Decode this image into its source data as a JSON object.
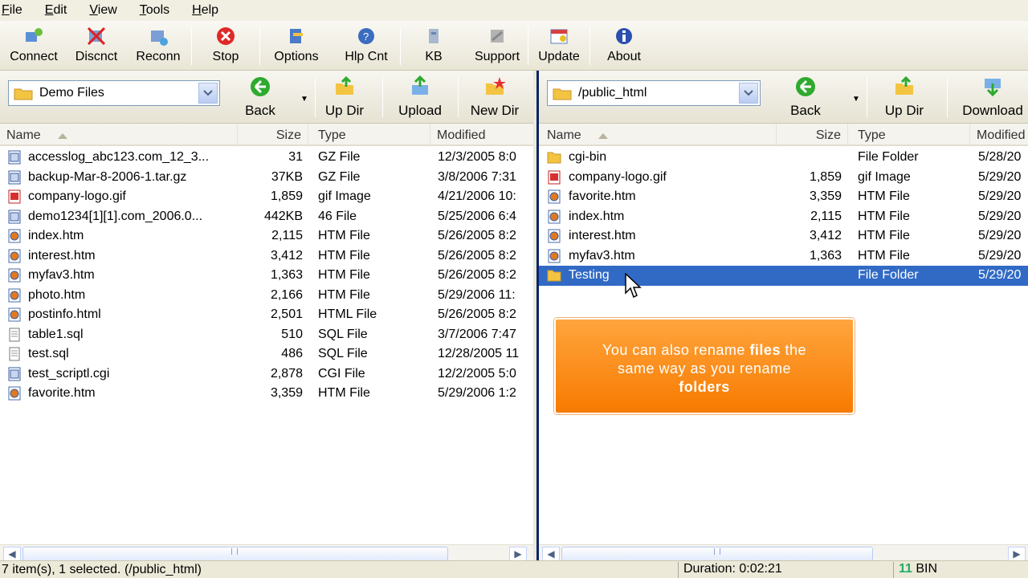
{
  "menu": [
    "File",
    "Edit",
    "View",
    "Tools",
    "Help"
  ],
  "toolbar": [
    {
      "label": "Connect",
      "icon": "connect-icon"
    },
    {
      "label": "Discnct",
      "icon": "disconnect-icon"
    },
    {
      "label": "Reconn",
      "icon": "reconnect-icon"
    },
    {
      "label": "Stop",
      "icon": "stop-icon"
    },
    {
      "label": "Options",
      "icon": "options-icon"
    },
    {
      "label": "Hlp Cnt",
      "icon": "help-center-icon"
    },
    {
      "label": "KB",
      "icon": "knowledge-base-icon"
    },
    {
      "label": "Support",
      "icon": "support-icon"
    },
    {
      "label": "Update",
      "icon": "update-icon"
    },
    {
      "label": "About",
      "icon": "about-icon"
    }
  ],
  "left": {
    "path": "Demo Files",
    "buttons": {
      "back": "Back",
      "updir": "Up Dir",
      "upload": "Upload",
      "newdir": "New Dir"
    },
    "columns": {
      "name": "Name",
      "size": "Size",
      "type": "Type",
      "modified": "Modified"
    },
    "files": [
      {
        "name": "accesslog_abc123.com_12_3...",
        "size": "31",
        "type": "GZ File",
        "modified": "12/3/2005 8:0",
        "kind": "archive"
      },
      {
        "name": "backup-Mar-8-2006-1.tar.gz",
        "size": "37KB",
        "type": "GZ File",
        "modified": "3/8/2006 7:31",
        "kind": "archive"
      },
      {
        "name": "company-logo.gif",
        "size": "1,859",
        "type": "gif Image",
        "modified": "4/21/2006 10:",
        "kind": "image"
      },
      {
        "name": "demo1234[1][1].com_2006.0...",
        "size": "442KB",
        "type": "46 File",
        "modified": "5/25/2006 6:4",
        "kind": "archive"
      },
      {
        "name": "index.htm",
        "size": "2,115",
        "type": "HTM File",
        "modified": "5/26/2005 8:2",
        "kind": "html"
      },
      {
        "name": "interest.htm",
        "size": "3,412",
        "type": "HTM File",
        "modified": "5/26/2005 8:2",
        "kind": "html"
      },
      {
        "name": "myfav3.htm",
        "size": "1,363",
        "type": "HTM File",
        "modified": "5/26/2005 8:2",
        "kind": "html"
      },
      {
        "name": "photo.htm",
        "size": "2,166",
        "type": "HTM File",
        "modified": "5/29/2006 11:",
        "kind": "html"
      },
      {
        "name": "postinfo.html",
        "size": "2,501",
        "type": "HTML File",
        "modified": "5/26/2005 8:2",
        "kind": "html"
      },
      {
        "name": "table1.sql",
        "size": "510",
        "type": "SQL File",
        "modified": "3/7/2006 7:47",
        "kind": "text"
      },
      {
        "name": "test.sql",
        "size": "486",
        "type": "SQL File",
        "modified": "12/28/2005 11",
        "kind": "text"
      },
      {
        "name": "test_scriptl.cgi",
        "size": "2,878",
        "type": "CGI File",
        "modified": "12/2/2005 5:0",
        "kind": "archive"
      },
      {
        "name": "favorite.htm",
        "size": "3,359",
        "type": "HTM File",
        "modified": "5/29/2006 1:2",
        "kind": "html"
      }
    ]
  },
  "right": {
    "path": "/public_html",
    "buttons": {
      "back": "Back",
      "updir": "Up Dir",
      "download": "Download"
    },
    "columns": {
      "name": "Name",
      "size": "Size",
      "type": "Type",
      "modified": "Modified"
    },
    "files": [
      {
        "name": "cgi-bin",
        "size": "",
        "type": "File Folder",
        "modified": "5/28/20",
        "kind": "folder"
      },
      {
        "name": "company-logo.gif",
        "size": "1,859",
        "type": "gif Image",
        "modified": "5/29/20",
        "kind": "image"
      },
      {
        "name": "favorite.htm",
        "size": "3,359",
        "type": "HTM File",
        "modified": "5/29/20",
        "kind": "html"
      },
      {
        "name": "index.htm",
        "size": "2,115",
        "type": "HTM File",
        "modified": "5/29/20",
        "kind": "html"
      },
      {
        "name": "interest.htm",
        "size": "3,412",
        "type": "HTM File",
        "modified": "5/29/20",
        "kind": "html"
      },
      {
        "name": "myfav3.htm",
        "size": "1,363",
        "type": "HTM File",
        "modified": "5/29/20",
        "kind": "html"
      },
      {
        "name": "Testing",
        "size": "",
        "type": "File Folder",
        "modified": "5/29/20",
        "kind": "folder",
        "selected": true
      }
    ]
  },
  "callout": {
    "line1_pre": "You can also rename ",
    "line1_bold": "files",
    "line1_post": " the",
    "line2": "same way as you rename",
    "line3_bold": "folders"
  },
  "status": {
    "items": "7 item(s), 1 selected.  (/public_html)",
    "duration": "Duration: 0:02:21",
    "mode": "BIN",
    "mode_prefix": "11"
  },
  "colors": {
    "selection": "#316ac5",
    "callout": "#f77a00",
    "pane_border": "#0a246a"
  }
}
